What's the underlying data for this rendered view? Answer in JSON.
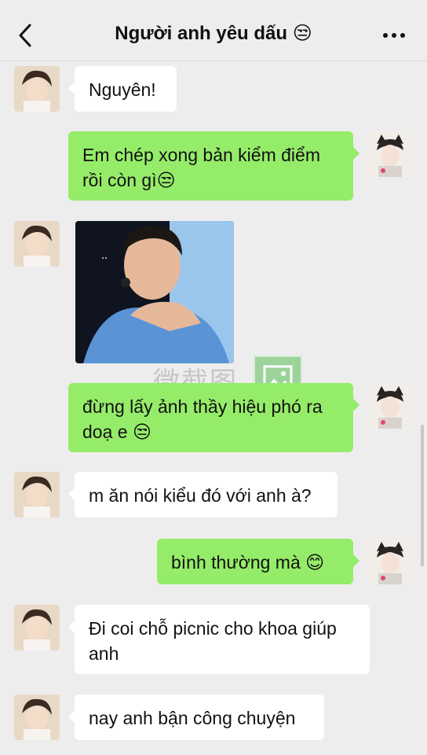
{
  "header": {
    "title": "Người anh yêu dấu 😒"
  },
  "messages": [
    {
      "side": "in",
      "text": "Nguyên!"
    },
    {
      "side": "out",
      "text": "Em chép xong bản kiểm điểm rồi còn gì😒"
    },
    {
      "side": "in",
      "type": "image",
      "alt": "photo"
    },
    {
      "side": "out",
      "text": "đừng lấy ảnh thầy hiệu phó ra doạ e 😒"
    },
    {
      "side": "in",
      "text": "m ăn nói kiểu đó với anh à?"
    },
    {
      "side": "out",
      "text": "bình thường mà 😊"
    },
    {
      "side": "in",
      "text": "Đi coi chỗ picnic cho khoa giúp anh"
    },
    {
      "side": "in",
      "text": "nay anh bận công chuyện"
    }
  ],
  "watermark": {
    "text": "微截图"
  },
  "colors": {
    "background": "#ededed",
    "incoming_bubble": "#ffffff",
    "outgoing_bubble": "#95ec69"
  }
}
